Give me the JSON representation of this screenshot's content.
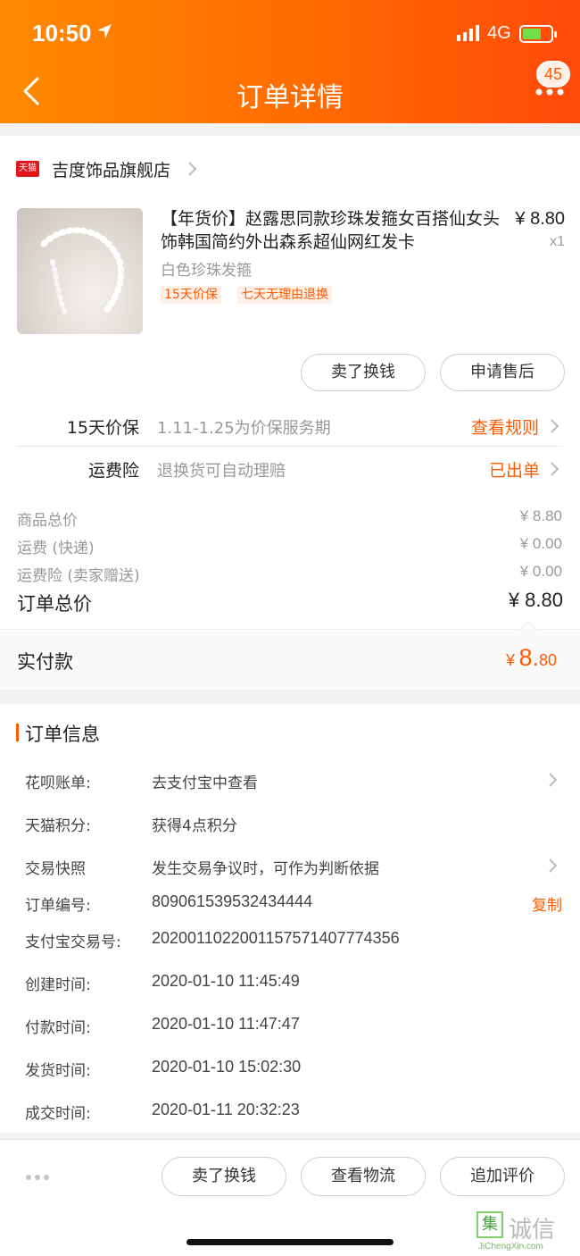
{
  "status_bar": {
    "time": "10:50",
    "network": "4G"
  },
  "nav": {
    "title": "订单详情",
    "badge_count": "45"
  },
  "shop": {
    "badge": "天猫",
    "name": "吉度饰品旗舰店"
  },
  "product": {
    "title": "【年货价】赵露思同款珍珠发箍女百搭仙女头饰韩国简约外出森系超仙网红发卡",
    "price": "¥ 8.80",
    "quantity": "x1",
    "sku": "白色珍珠发箍",
    "tags": [
      "15天价保",
      "七天无理由退换"
    ]
  },
  "item_actions": {
    "sell_label": "卖了换钱",
    "after_sale_label": "申请售后"
  },
  "services": [
    {
      "label": "15天价保",
      "desc": "1.11-1.25为价保服务期",
      "link": "查看规则"
    },
    {
      "label": "运费险",
      "desc": "退换货可自动理赔",
      "link": "已出单"
    }
  ],
  "fees": [
    {
      "label": "商品总价",
      "value": "¥ 8.80"
    },
    {
      "label": "运费 (快递)",
      "value": "¥ 0.00"
    },
    {
      "label": "运费险 (卖家赠送)",
      "value": "¥ 0.00"
    }
  ],
  "order_total": {
    "label": "订单总价",
    "value": "¥ 8.80"
  },
  "paid": {
    "label": "实付款",
    "currency": "¥",
    "integer": "8.",
    "decimal": "80"
  },
  "order_info": {
    "title": "订单信息",
    "rows": [
      {
        "label": "花呗账单:",
        "value": "去支付宝中查看"
      },
      {
        "label": "天猫积分:",
        "value": "获得4点积分"
      },
      {
        "label": "交易快照",
        "value": "发生交易争议时，可作为判断依据"
      },
      {
        "label": "订单编号:",
        "value": "809061539532434444"
      },
      {
        "label": "支付宝交易号:",
        "value": "2020011022001157571407774356"
      },
      {
        "label": "创建时间:",
        "value": "2020-01-10 11:45:49"
      },
      {
        "label": "付款时间:",
        "value": "2020-01-10 11:47:47"
      },
      {
        "label": "发货时间:",
        "value": "2020-01-10 15:02:30"
      },
      {
        "label": "成交时间:",
        "value": "2020-01-11 20:32:23"
      }
    ],
    "copy_label": "复制"
  },
  "bottom_bar": {
    "buttons": [
      "卖了换钱",
      "查看物流",
      "追加评价"
    ]
  },
  "watermark": {
    "glyph": "集",
    "text": "诚信",
    "sub": "JiChengXin.com"
  },
  "colors": {
    "accent": "#ff5a00",
    "header_start": "#ff8a00",
    "header_end": "#ff4a0a",
    "tmall_red": "#e0161b"
  },
  "icons": [
    "back-icon",
    "more-icon",
    "location-arrow-icon",
    "signal-icon",
    "battery-icon",
    "chevron-right-icon",
    "ellipsis-icon"
  ]
}
